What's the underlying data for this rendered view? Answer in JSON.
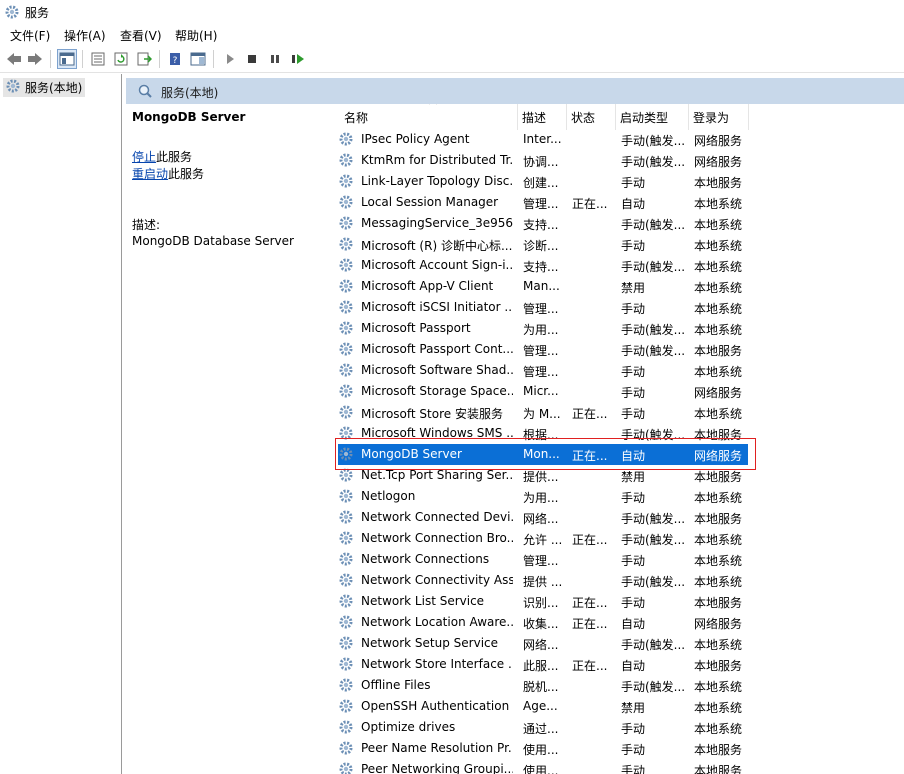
{
  "window": {
    "title": "服务"
  },
  "menu": [
    {
      "id": "file",
      "label": "文件(F)"
    },
    {
      "id": "action",
      "label": "操作(A)"
    },
    {
      "id": "view",
      "label": "查看(V)"
    },
    {
      "id": "help",
      "label": "帮助(H)"
    }
  ],
  "tree": {
    "root_label": "服务(本地)"
  },
  "pane": {
    "header_label": "服务(本地)"
  },
  "detail": {
    "service_name": "MongoDB Server",
    "stop_link": "停止",
    "stop_suffix": "此服务",
    "restart_link": "重启动",
    "restart_suffix": "此服务",
    "desc_label": "描述:",
    "desc_text": "MongoDB Database Server"
  },
  "columns": {
    "name": "名称",
    "desc": "描述",
    "status": "状态",
    "startup": "启动类型",
    "logon": "登录为"
  },
  "rows": [
    {
      "name": "IPsec Policy Agent",
      "desc": "Inter...",
      "status": "",
      "startup": "手动(触发...",
      "logon": "网络服务"
    },
    {
      "name": "KtmRm for Distributed Tr...",
      "desc": "协调...",
      "status": "",
      "startup": "手动(触发...",
      "logon": "网络服务"
    },
    {
      "name": "Link-Layer Topology Disc...",
      "desc": "创建...",
      "status": "",
      "startup": "手动",
      "logon": "本地服务"
    },
    {
      "name": "Local Session Manager",
      "desc": "管理...",
      "status": "正在...",
      "startup": "自动",
      "logon": "本地系统"
    },
    {
      "name": "MessagingService_3e956...",
      "desc": "支持...",
      "status": "",
      "startup": "手动(触发...",
      "logon": "本地系统"
    },
    {
      "name": "Microsoft (R) 诊断中心标...",
      "desc": "诊断...",
      "status": "",
      "startup": "手动",
      "logon": "本地系统"
    },
    {
      "name": "Microsoft Account Sign-i...",
      "desc": "支持...",
      "status": "",
      "startup": "手动(触发...",
      "logon": "本地系统"
    },
    {
      "name": "Microsoft App-V Client",
      "desc": "Man...",
      "status": "",
      "startup": "禁用",
      "logon": "本地系统"
    },
    {
      "name": "Microsoft iSCSI Initiator ...",
      "desc": "管理...",
      "status": "",
      "startup": "手动",
      "logon": "本地系统"
    },
    {
      "name": "Microsoft Passport",
      "desc": "为用...",
      "status": "",
      "startup": "手动(触发...",
      "logon": "本地系统"
    },
    {
      "name": "Microsoft Passport Cont...",
      "desc": "管理...",
      "status": "",
      "startup": "手动(触发...",
      "logon": "本地服务"
    },
    {
      "name": "Microsoft Software Shad...",
      "desc": "管理...",
      "status": "",
      "startup": "手动",
      "logon": "本地系统"
    },
    {
      "name": "Microsoft Storage Space...",
      "desc": "Micr...",
      "status": "",
      "startup": "手动",
      "logon": "网络服务"
    },
    {
      "name": "Microsoft Store 安装服务",
      "desc": "为 M...",
      "status": "正在...",
      "startup": "手动",
      "logon": "本地系统"
    },
    {
      "name": "Microsoft Windows SMS ...",
      "desc": "根据...",
      "status": "",
      "startup": "手动(触发...",
      "logon": "本地服务"
    },
    {
      "name": "MongoDB Server",
      "desc": "Mon...",
      "status": "正在...",
      "startup": "自动",
      "logon": "网络服务",
      "selected": true
    },
    {
      "name": "Net.Tcp Port Sharing Ser...",
      "desc": "提供...",
      "status": "",
      "startup": "禁用",
      "logon": "本地服务"
    },
    {
      "name": "Netlogon",
      "desc": "为用...",
      "status": "",
      "startup": "手动",
      "logon": "本地系统"
    },
    {
      "name": "Network Connected Devi...",
      "desc": "网络...",
      "status": "",
      "startup": "手动(触发...",
      "logon": "本地服务"
    },
    {
      "name": "Network Connection Bro...",
      "desc": "允许 ...",
      "status": "正在...",
      "startup": "手动(触发...",
      "logon": "本地系统"
    },
    {
      "name": "Network Connections",
      "desc": "管理...",
      "status": "",
      "startup": "手动",
      "logon": "本地系统"
    },
    {
      "name": "Network Connectivity Ass...",
      "desc": "提供 ...",
      "status": "",
      "startup": "手动(触发...",
      "logon": "本地系统"
    },
    {
      "name": "Network List Service",
      "desc": "识别...",
      "status": "正在...",
      "startup": "手动",
      "logon": "本地服务"
    },
    {
      "name": "Network Location Aware...",
      "desc": "收集...",
      "status": "正在...",
      "startup": "自动",
      "logon": "网络服务"
    },
    {
      "name": "Network Setup Service",
      "desc": "网络...",
      "status": "",
      "startup": "手动(触发...",
      "logon": "本地系统"
    },
    {
      "name": "Network Store Interface ...",
      "desc": "此服...",
      "status": "正在...",
      "startup": "自动",
      "logon": "本地服务"
    },
    {
      "name": "Offline Files",
      "desc": "脱机...",
      "status": "",
      "startup": "手动(触发...",
      "logon": "本地系统"
    },
    {
      "name": "OpenSSH Authentication ...",
      "desc": "Age...",
      "status": "",
      "startup": "禁用",
      "logon": "本地系统"
    },
    {
      "name": "Optimize drives",
      "desc": "通过...",
      "status": "",
      "startup": "手动",
      "logon": "本地系统"
    },
    {
      "name": "Peer Name Resolution Pr...",
      "desc": "使用...",
      "status": "",
      "startup": "手动",
      "logon": "本地服务"
    },
    {
      "name": "Peer Networking Groupi...",
      "desc": "使用...",
      "status": "",
      "startup": "手动",
      "logon": "本地服务"
    }
  ],
  "colors": {
    "selection": "#0b6fd6",
    "pane_header": "#c8d8ea",
    "highlight_box": "#e02020"
  }
}
